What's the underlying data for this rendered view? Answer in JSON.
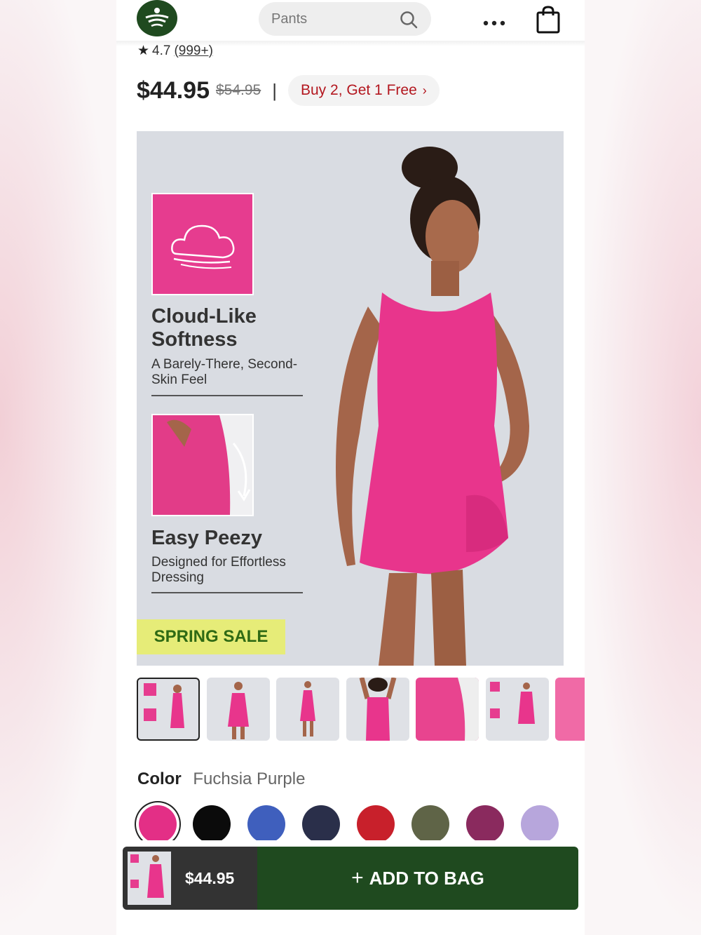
{
  "header": {
    "search_placeholder": "Pants"
  },
  "product": {
    "rating": "4.7",
    "rating_count": "(999+)",
    "price": "$44.95",
    "original_price": "$54.95",
    "separator": "|",
    "promo_label": "Buy 2, Get 1 Free"
  },
  "hero": {
    "feature1_title": "Cloud-Like Softness",
    "feature1_subtitle": "A Barely-There, Second-Skin Feel",
    "feature2_title": "Easy Peezy",
    "feature2_subtitle": "Designed for Effortless Dressing",
    "sale_badge": "SPRING SALE"
  },
  "color": {
    "label": "Color",
    "selected_name": "Fuchsia Purple",
    "swatches": [
      "#e32f86",
      "#0b0b0b",
      "#3f5fbd",
      "#2a2f4a",
      "#c8202b",
      "#5f6447",
      "#8a2a5e",
      "#b7a6dc"
    ]
  },
  "bottom_bar": {
    "price": "$44.95",
    "add_to_bag": "ADD TO BAG"
  }
}
